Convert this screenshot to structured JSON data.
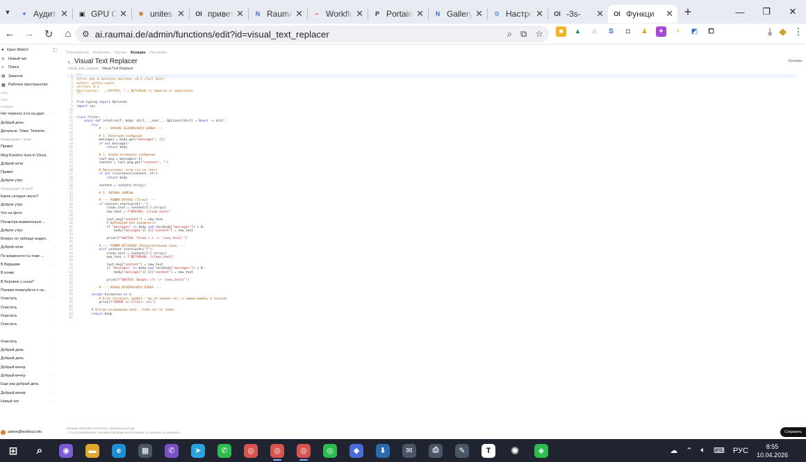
{
  "browser": {
    "tabs": [
      {
        "label": "Аудит и",
        "color": "#3d7be0",
        "icon": "sparkle-icon"
      },
      {
        "label": "GPU Cl",
        "color": "#222222",
        "icon": "box-icon"
      },
      {
        "label": "unites",
        "color": "#c27a2a",
        "icon": "star-icon"
      },
      {
        "label": "привет",
        "color": "#333333",
        "icon": "oi-icon"
      },
      {
        "label": "RaumAI",
        "color": "#4a6bd8",
        "icon": "n-icon"
      },
      {
        "label": "Workflo",
        "color": "#d9534f",
        "icon": "workflow-icon"
      },
      {
        "label": "Portaine",
        "color": "#333333",
        "icon": "p-icon"
      },
      {
        "label": "Gallery",
        "color": "#4a6bd8",
        "icon": "n-icon"
      },
      {
        "label": "Настрой",
        "color": "#3d7be0",
        "icon": "gear-icon"
      },
      {
        "label": "-3s-",
        "color": "#333333",
        "icon": "oi-icon"
      },
      {
        "label": "Функци",
        "color": "#333333",
        "icon": "oi-icon",
        "active": true
      }
    ],
    "url": "ai.raumai.de/admin/functions/edit?id=visual_text_replacer"
  },
  "sidebar": {
    "brand": "Open WebUI",
    "nav": [
      {
        "label": "Новый чат",
        "icon": "pencil-icon"
      },
      {
        "label": "Поиск",
        "icon": "search-icon"
      },
      {
        "label": "Заметки",
        "icon": "note-icon"
      },
      {
        "label": "Рабочее пространство",
        "icon": "grid-icon"
      }
    ],
    "groups": [
      {
        "title": "чаты",
        "items": []
      },
      {
        "title": "чаты",
        "items": []
      },
      {
        "title": "Сегодня",
        "items": [
          "Нет перенос в tvi на дает ...",
          "Добрый день",
          "Детально. Тема: Техниче..."
        ]
      },
      {
        "title": "Предыдущие 7 дней",
        "items": [
          "Привет",
          "Meg Korobov lives in Chica...",
          "Доброй ночи",
          "Привет",
          "Доброе утро"
        ]
      },
      {
        "title": "Предыдущие 30 дней",
        "items": [
          "Какое сегодня число?",
          "Доброе утро",
          "Что на фото",
          "Посмотри внимательно ...",
          "Доброе утро",
          "Вопрос по таблице модел...",
          "Доброй ночи",
          "По влажности ты тоже ...",
          "В Варшаве",
          "В конве",
          "В Берлине у сына?",
          "Покажи пожалуйста о на...",
          "Очистить",
          "Очистить",
          "Очистить",
          "Очистить",
          "",
          "Очистить",
          "Добрый день",
          "Добрый день",
          "Добрый вечер",
          "Добрый вечер",
          "Еще раз добрый день",
          "Добрый вечер",
          "Новый чат"
        ]
      }
    ],
    "user": "admin@buildout.info"
  },
  "main": {
    "crumbs": [
      "Пользователи",
      "Аналитика",
      "Оценки",
      "Функции",
      "Настройки"
    ],
    "active_crumb": 3,
    "back_label": "‹",
    "title": "Visual Text Replacer",
    "subtitle_id": "visual_text_replacer",
    "subtitle_name": "Visual Text Replacer",
    "side_label": "Функции",
    "save_label": "Сохранить",
    "footnote_1": "Функции позволяют выполнять произвольный код.",
    "footnote_2": "⚠ Не устанавливайте случайные функции из источников, которым вы не доверяете.",
    "code_lines": [
      "\"\"\"",
      "title: Dot & Question Switcher v8.1 (Fail Safe)",
      "author: unites.space",
      "version: 8.1",
      "description: . = КРАТКО, ? = ДЕТАЛЬНО (с защитой от зависания)",
      "\"\"\"",
      "",
      "from typing import Optional",
      "import sys",
      "",
      "",
      "class Filter:",
      "    async def inlet(self, body: dict, __user__: Optional[dict] = None) -> dict:",
      "        try:",
      "            # --- НАЧАЛО БЕЗОПАСНОГО БЛОКА ---",
      "",
      "            # 1. Получаем сообщения",
      "            messages = body.get(\"messages\", [])",
      "            if not messages:",
      "                return body",
      "",
      "            # 2. Берем последнее сообщение",
      "            last_msg = messages[-1]",
      "            content = last_msg.get(\"content\", \"\")",
      "",
      "            # Пропускаем, если это не текст",
      "            if not isinstance(content, str):",
      "                return body",
      "",
      "            content = content.strip()",
      "",
      "            # 3. ЛОГИКА ЗАМЕНЫ",
      "",
      "            # --- РЕЖИМ КРАТКО (Точка) ---",
      "            if content.startswith(\".\"):",
      "                clean_text = content[1:].strip()",
      "                new_text = f\"КРАТКО: {clean_text}\"",
      "",
      "                last_msg[\"content\"] = new_text",
      "                # Дублируем для надежности",
      "                if \"messages\" in body and len(body[\"messages\"]) > 0:",
      "                    body[\"messages\"][-1][\"content\"] = new_text",
      "",
      "                print(f\"SWITCH: Точка (.) -> '{new_text}'\")",
      "",
      "            # --- РЕЖИМ ДЕТАЛЬНО (Вопросительный знак) ---",
      "            elif content.startswith(\"?\"):",
      "                clean_text = content[1:].strip()",
      "                new_text = f\"ДЕТАЛЬНО: {clean_text}\"",
      "",
      "                last_msg[\"content\"] = new_text",
      "                if \"messages\" in body and len(body[\"messages\"]) > 0:",
      "                    body[\"messages\"][-1][\"content\"] = new_text",
      "",
      "                print(f\"SWITCH: Вопрос (?) -> '{new_text}'\")",
      "",
      "            # --- КОНЕЦ БЕЗОПАСНОГО БЛОКА ---",
      "",
      "        except Exception as e:",
      "            # Если случилась ошибка - мы не ломаем чат, а пишем ошибку в консоль",
      "            print(f\"ERROR in Filter: {e}\")",
      "",
      "        # Всегда возвращаем body, чтобы чат не завис",
      "        return body",
      ""
    ]
  },
  "taskbar": {
    "language": "РУС",
    "time": "8:55",
    "date": "10.04.2026",
    "apps": [
      {
        "name": "windows-start-icon",
        "color": "#2b2f3a",
        "glyph": "⊞"
      },
      {
        "name": "search-icon",
        "color": "#2b2f3a",
        "glyph": "⌕"
      },
      {
        "name": "copilot-icon",
        "color": "#7b5bd6",
        "glyph": "◉"
      },
      {
        "name": "file-explorer-icon",
        "color": "#e0a82e",
        "glyph": "▬"
      },
      {
        "name": "edge-icon",
        "color": "#1d8fd6",
        "glyph": "e"
      },
      {
        "name": "calculator-icon",
        "color": "#4a5568",
        "glyph": "▦"
      },
      {
        "name": "viber-icon",
        "color": "#7b51c9",
        "glyph": "✆"
      },
      {
        "name": "telegram-icon",
        "color": "#2aa3e0",
        "glyph": "➤"
      },
      {
        "name": "whatsapp-icon",
        "color": "#2dbd4f",
        "glyph": "✆"
      },
      {
        "name": "chrome-icon",
        "color": "#d9534f",
        "glyph": "◎"
      },
      {
        "name": "chrome-profile-icon",
        "color": "#d9534f",
        "glyph": "◎",
        "active": true
      },
      {
        "name": "chrome-profile-2-icon",
        "color": "#d9534f",
        "glyph": "◎",
        "active": true
      },
      {
        "name": "chrome-profile-3-icon",
        "color": "#2dbd4f",
        "glyph": "◎"
      },
      {
        "name": "app-icon",
        "color": "#4a6bd8",
        "glyph": "◆"
      },
      {
        "name": "download-icon",
        "color": "#2b6cb0",
        "glyph": "⬇"
      },
      {
        "name": "mail-icon",
        "color": "#4a5568",
        "glyph": "✉"
      },
      {
        "name": "printer-icon",
        "color": "#4a5568",
        "glyph": "⎙"
      },
      {
        "name": "tool-icon",
        "color": "#4a5568",
        "glyph": "✎"
      },
      {
        "name": "typora-icon",
        "color": "#ffffff",
        "glyph": "T"
      },
      {
        "name": "openai-icon",
        "color": "#2b2f3a",
        "glyph": "✺"
      },
      {
        "name": "green-app-icon",
        "color": "#2dbd4f",
        "glyph": "◈"
      }
    ]
  }
}
